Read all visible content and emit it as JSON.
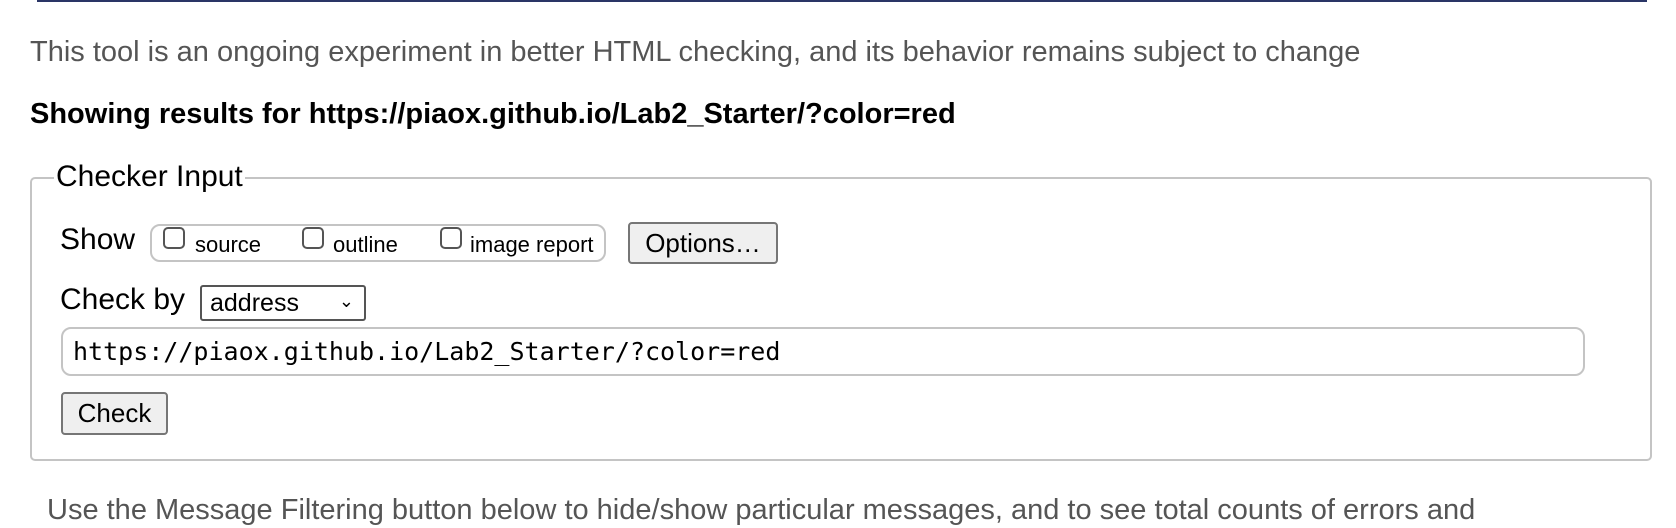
{
  "intro": "This tool is an ongoing experiment in better HTML checking, and its behavior remains subject to change",
  "heading": "Showing results for https://piaox.github.io/Lab2_Starter/?color=red",
  "checker": {
    "legend": "Checker Input",
    "show_label": "Show",
    "show_options": [
      {
        "label": "source",
        "checked": false
      },
      {
        "label": "outline",
        "checked": false
      },
      {
        "label": "image report",
        "checked": false
      }
    ],
    "options_button": "Options…",
    "check_by_label": "Check by",
    "check_by_value": "address",
    "url_value": "https://piaox.github.io/Lab2_Starter/?color=red",
    "check_button": "Check"
  },
  "filter_text": "Use the Message Filtering button below to hide/show particular messages, and to see total counts of errors and"
}
